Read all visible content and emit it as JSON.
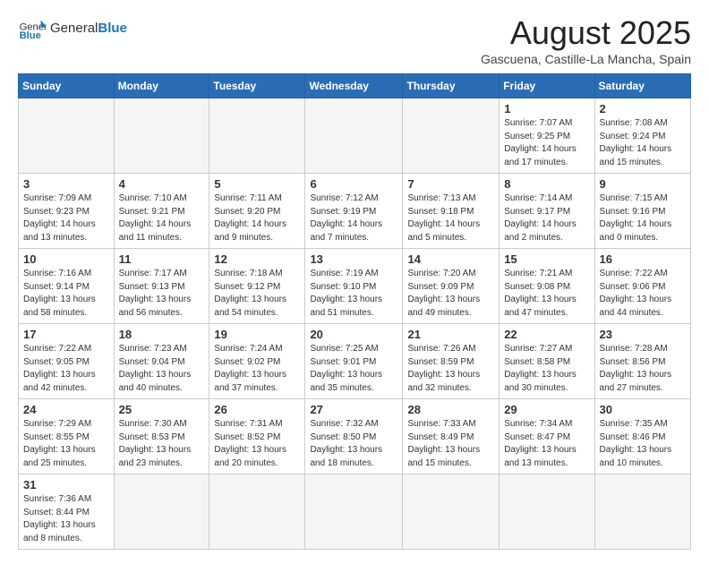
{
  "header": {
    "logo_general": "General",
    "logo_blue": "Blue",
    "month_title": "August 2025",
    "location": "Gascuena, Castille-La Mancha, Spain"
  },
  "weekdays": [
    "Sunday",
    "Monday",
    "Tuesday",
    "Wednesday",
    "Thursday",
    "Friday",
    "Saturday"
  ],
  "weeks": [
    [
      {
        "day": "",
        "info": ""
      },
      {
        "day": "",
        "info": ""
      },
      {
        "day": "",
        "info": ""
      },
      {
        "day": "",
        "info": ""
      },
      {
        "day": "",
        "info": ""
      },
      {
        "day": "1",
        "info": "Sunrise: 7:07 AM\nSunset: 9:25 PM\nDaylight: 14 hours and 17 minutes."
      },
      {
        "day": "2",
        "info": "Sunrise: 7:08 AM\nSunset: 9:24 PM\nDaylight: 14 hours and 15 minutes."
      }
    ],
    [
      {
        "day": "3",
        "info": "Sunrise: 7:09 AM\nSunset: 9:23 PM\nDaylight: 14 hours and 13 minutes."
      },
      {
        "day": "4",
        "info": "Sunrise: 7:10 AM\nSunset: 9:21 PM\nDaylight: 14 hours and 11 minutes."
      },
      {
        "day": "5",
        "info": "Sunrise: 7:11 AM\nSunset: 9:20 PM\nDaylight: 14 hours and 9 minutes."
      },
      {
        "day": "6",
        "info": "Sunrise: 7:12 AM\nSunset: 9:19 PM\nDaylight: 14 hours and 7 minutes."
      },
      {
        "day": "7",
        "info": "Sunrise: 7:13 AM\nSunset: 9:18 PM\nDaylight: 14 hours and 5 minutes."
      },
      {
        "day": "8",
        "info": "Sunrise: 7:14 AM\nSunset: 9:17 PM\nDaylight: 14 hours and 2 minutes."
      },
      {
        "day": "9",
        "info": "Sunrise: 7:15 AM\nSunset: 9:16 PM\nDaylight: 14 hours and 0 minutes."
      }
    ],
    [
      {
        "day": "10",
        "info": "Sunrise: 7:16 AM\nSunset: 9:14 PM\nDaylight: 13 hours and 58 minutes."
      },
      {
        "day": "11",
        "info": "Sunrise: 7:17 AM\nSunset: 9:13 PM\nDaylight: 13 hours and 56 minutes."
      },
      {
        "day": "12",
        "info": "Sunrise: 7:18 AM\nSunset: 9:12 PM\nDaylight: 13 hours and 54 minutes."
      },
      {
        "day": "13",
        "info": "Sunrise: 7:19 AM\nSunset: 9:10 PM\nDaylight: 13 hours and 51 minutes."
      },
      {
        "day": "14",
        "info": "Sunrise: 7:20 AM\nSunset: 9:09 PM\nDaylight: 13 hours and 49 minutes."
      },
      {
        "day": "15",
        "info": "Sunrise: 7:21 AM\nSunset: 9:08 PM\nDaylight: 13 hours and 47 minutes."
      },
      {
        "day": "16",
        "info": "Sunrise: 7:22 AM\nSunset: 9:06 PM\nDaylight: 13 hours and 44 minutes."
      }
    ],
    [
      {
        "day": "17",
        "info": "Sunrise: 7:22 AM\nSunset: 9:05 PM\nDaylight: 13 hours and 42 minutes."
      },
      {
        "day": "18",
        "info": "Sunrise: 7:23 AM\nSunset: 9:04 PM\nDaylight: 13 hours and 40 minutes."
      },
      {
        "day": "19",
        "info": "Sunrise: 7:24 AM\nSunset: 9:02 PM\nDaylight: 13 hours and 37 minutes."
      },
      {
        "day": "20",
        "info": "Sunrise: 7:25 AM\nSunset: 9:01 PM\nDaylight: 13 hours and 35 minutes."
      },
      {
        "day": "21",
        "info": "Sunrise: 7:26 AM\nSunset: 8:59 PM\nDaylight: 13 hours and 32 minutes."
      },
      {
        "day": "22",
        "info": "Sunrise: 7:27 AM\nSunset: 8:58 PM\nDaylight: 13 hours and 30 minutes."
      },
      {
        "day": "23",
        "info": "Sunrise: 7:28 AM\nSunset: 8:56 PM\nDaylight: 13 hours and 27 minutes."
      }
    ],
    [
      {
        "day": "24",
        "info": "Sunrise: 7:29 AM\nSunset: 8:55 PM\nDaylight: 13 hours and 25 minutes."
      },
      {
        "day": "25",
        "info": "Sunrise: 7:30 AM\nSunset: 8:53 PM\nDaylight: 13 hours and 23 minutes."
      },
      {
        "day": "26",
        "info": "Sunrise: 7:31 AM\nSunset: 8:52 PM\nDaylight: 13 hours and 20 minutes."
      },
      {
        "day": "27",
        "info": "Sunrise: 7:32 AM\nSunset: 8:50 PM\nDaylight: 13 hours and 18 minutes."
      },
      {
        "day": "28",
        "info": "Sunrise: 7:33 AM\nSunset: 8:49 PM\nDaylight: 13 hours and 15 minutes."
      },
      {
        "day": "29",
        "info": "Sunrise: 7:34 AM\nSunset: 8:47 PM\nDaylight: 13 hours and 13 minutes."
      },
      {
        "day": "30",
        "info": "Sunrise: 7:35 AM\nSunset: 8:46 PM\nDaylight: 13 hours and 10 minutes."
      }
    ],
    [
      {
        "day": "31",
        "info": "Sunrise: 7:36 AM\nSunset: 8:44 PM\nDaylight: 13 hours and 8 minutes."
      },
      {
        "day": "",
        "info": ""
      },
      {
        "day": "",
        "info": ""
      },
      {
        "day": "",
        "info": ""
      },
      {
        "day": "",
        "info": ""
      },
      {
        "day": "",
        "info": ""
      },
      {
        "day": "",
        "info": ""
      }
    ]
  ]
}
